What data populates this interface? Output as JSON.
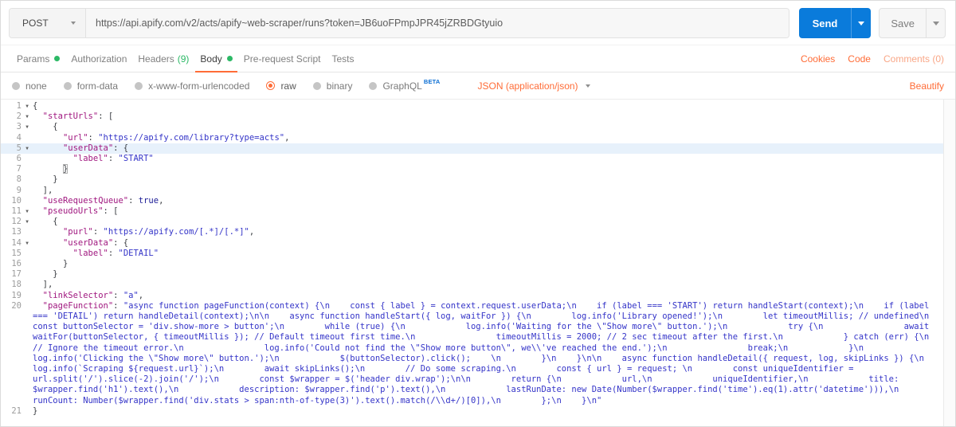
{
  "request_bar": {
    "method": "POST",
    "url": "https://api.apify.com/v2/acts/apify~web-scraper/runs?token=JB6uoFPmpJPR45jZRBDGtyuio",
    "send_label": "Send",
    "save_label": "Save"
  },
  "tabs": {
    "items": [
      {
        "label": "Params",
        "dot": true,
        "active": false
      },
      {
        "label": "Authorization",
        "active": false
      },
      {
        "label": "Headers",
        "count": "(9)",
        "active": false
      },
      {
        "label": "Body",
        "dot": true,
        "active": true
      },
      {
        "label": "Pre-request Script",
        "active": false
      },
      {
        "label": "Tests",
        "active": false
      }
    ],
    "right": [
      "Cookies",
      "Code",
      "Comments (0)"
    ]
  },
  "body_type_bar": {
    "options": [
      {
        "label": "none",
        "selected": false
      },
      {
        "label": "form-data",
        "selected": false
      },
      {
        "label": "x-www-form-urlencoded",
        "selected": false
      },
      {
        "label": "raw",
        "selected": true
      },
      {
        "label": "binary",
        "selected": false
      },
      {
        "label": "GraphQL",
        "selected": false,
        "badge": "BETA"
      }
    ],
    "content_type": "JSON (application/json)",
    "beautify_label": "Beautify"
  },
  "colors": {
    "accent_orange": "#FF6C37",
    "green": "#2CB966",
    "send_blue": "#0A7BDB",
    "beta_blue": "#0C6FD4",
    "json_key": "#A0177F",
    "json_string": "#3434C8",
    "json_atom": "#1B1B96",
    "active_line_bg": "#E7F1FB"
  },
  "editor": {
    "lines": [
      {
        "num": "1",
        "fold": true,
        "tokens": [
          {
            "c": "p",
            "t": "{"
          }
        ]
      },
      {
        "num": "2",
        "fold": true,
        "tokens": [
          {
            "c": "p",
            "t": "  "
          },
          {
            "c": "key",
            "t": "\"startUrls\""
          },
          {
            "c": "p",
            "t": ": ["
          }
        ]
      },
      {
        "num": "3",
        "fold": true,
        "tokens": [
          {
            "c": "p",
            "t": "    {"
          }
        ]
      },
      {
        "num": "4",
        "tokens": [
          {
            "c": "p",
            "t": "      "
          },
          {
            "c": "key",
            "t": "\"url\""
          },
          {
            "c": "p",
            "t": ": "
          },
          {
            "c": "str",
            "t": "\"https://apify.com/library?type=acts\""
          },
          {
            "c": "p",
            "t": ","
          }
        ]
      },
      {
        "num": "5",
        "fold": true,
        "highlight": true,
        "tokens": [
          {
            "c": "p",
            "t": "      "
          },
          {
            "c": "key",
            "t": "\"userData\""
          },
          {
            "c": "p",
            "t": ": {"
          }
        ]
      },
      {
        "num": "6",
        "tokens": [
          {
            "c": "p",
            "t": "        "
          },
          {
            "c": "key",
            "t": "\"label\""
          },
          {
            "c": "p",
            "t": ": "
          },
          {
            "c": "str",
            "t": "\"START\""
          }
        ]
      },
      {
        "num": "7",
        "tokens": [
          {
            "c": "p",
            "t": "      "
          },
          {
            "c": "match",
            "t": "}"
          }
        ]
      },
      {
        "num": "8",
        "tokens": [
          {
            "c": "p",
            "t": "    }"
          }
        ]
      },
      {
        "num": "9",
        "tokens": [
          {
            "c": "p",
            "t": "  ],"
          }
        ]
      },
      {
        "num": "10",
        "tokens": [
          {
            "c": "p",
            "t": "  "
          },
          {
            "c": "key",
            "t": "\"useRequestQueue\""
          },
          {
            "c": "p",
            "t": ": "
          },
          {
            "c": "atom",
            "t": "true"
          },
          {
            "c": "p",
            "t": ","
          }
        ]
      },
      {
        "num": "11",
        "fold": true,
        "tokens": [
          {
            "c": "p",
            "t": "  "
          },
          {
            "c": "key",
            "t": "\"pseudoUrls\""
          },
          {
            "c": "p",
            "t": ": ["
          }
        ]
      },
      {
        "num": "12",
        "fold": true,
        "tokens": [
          {
            "c": "p",
            "t": "    {"
          }
        ]
      },
      {
        "num": "13",
        "tokens": [
          {
            "c": "p",
            "t": "      "
          },
          {
            "c": "key",
            "t": "\"purl\""
          },
          {
            "c": "p",
            "t": ": "
          },
          {
            "c": "str",
            "t": "\"https://apify.com/[.*]/[.*]\""
          },
          {
            "c": "p",
            "t": ","
          }
        ]
      },
      {
        "num": "14",
        "fold": true,
        "tokens": [
          {
            "c": "p",
            "t": "      "
          },
          {
            "c": "key",
            "t": "\"userData\""
          },
          {
            "c": "p",
            "t": ": {"
          }
        ]
      },
      {
        "num": "15",
        "tokens": [
          {
            "c": "p",
            "t": "        "
          },
          {
            "c": "key",
            "t": "\"label\""
          },
          {
            "c": "p",
            "t": ": "
          },
          {
            "c": "str",
            "t": "\"DETAIL\""
          }
        ]
      },
      {
        "num": "16",
        "tokens": [
          {
            "c": "p",
            "t": "      }"
          }
        ]
      },
      {
        "num": "17",
        "tokens": [
          {
            "c": "p",
            "t": "    }"
          }
        ]
      },
      {
        "num": "18",
        "tokens": [
          {
            "c": "p",
            "t": "  ],"
          }
        ]
      },
      {
        "num": "19",
        "tokens": [
          {
            "c": "p",
            "t": "  "
          },
          {
            "c": "key",
            "t": "\"linkSelector\""
          },
          {
            "c": "p",
            "t": ": "
          },
          {
            "c": "str",
            "t": "\"a\""
          },
          {
            "c": "p",
            "t": ","
          }
        ]
      },
      {
        "num": "20",
        "tokens": [
          {
            "c": "p",
            "t": "  "
          },
          {
            "c": "key",
            "t": "\"pageFunction\""
          },
          {
            "c": "p",
            "t": ": "
          },
          {
            "c": "str",
            "t": "\"async function pageFunction(context) {\\n    const { label } = context.request.userData;\\n    if (label === 'START') return handleStart(context);\\n    if (label === 'DETAIL') return handleDetail(context);\\n\\n    async function handleStart({ log, waitFor }) {\\n        log.info('Library opened!');\\n        let timeoutMillis; // undefined\\n        const buttonSelector = 'div.show-more > button';\\n        while (true) {\\n            log.info('Waiting for the \\\"Show more\\\" button.');\\n            try {\\n                await waitFor(buttonSelector, { timeoutMillis }); // Default timeout first time.\\n                timeoutMillis = 2000; // 2 sec timeout after the first.\\n            } catch (err) {\\n                // Ignore the timeout error.\\n                log.info('Could not find the \\\"Show more button\\\", we\\\\'ve reached the end.');\\n                break;\\n            }\\n            log.info('Clicking the \\\"Show more\\\" button.');\\n            $(buttonSelector).click();    \\n        }\\n    }\\n\\n    async function handleDetail({ request, log, skipLinks }) {\\n        log.info(`Scraping ${request.url}`);\\n        await skipLinks();\\n        // Do some scraping.\\n        const { url } = request; \\n        const uniqueIdentifier = url.split('/').slice(-2).join('/');\\n        const $wrapper = $('header div.wrap');\\n\\n        return {\\n            url,\\n            uniqueIdentifier,\\n            title: $wrapper.find('h1').text(),\\n            description: $wrapper.find('p').text(),\\n            lastRunDate: new Date(Number($wrapper.find('time').eq(1).attr('datetime'))),\\n            runCount: Number($wrapper.find('div.stats > span:nth-of-type(3)').text().match(/\\\\d+/)[0]),\\n        };\\n    }\\n\""
          }
        ]
      },
      {
        "num": "21",
        "tokens": [
          {
            "c": "p",
            "t": "}"
          }
        ]
      }
    ]
  }
}
